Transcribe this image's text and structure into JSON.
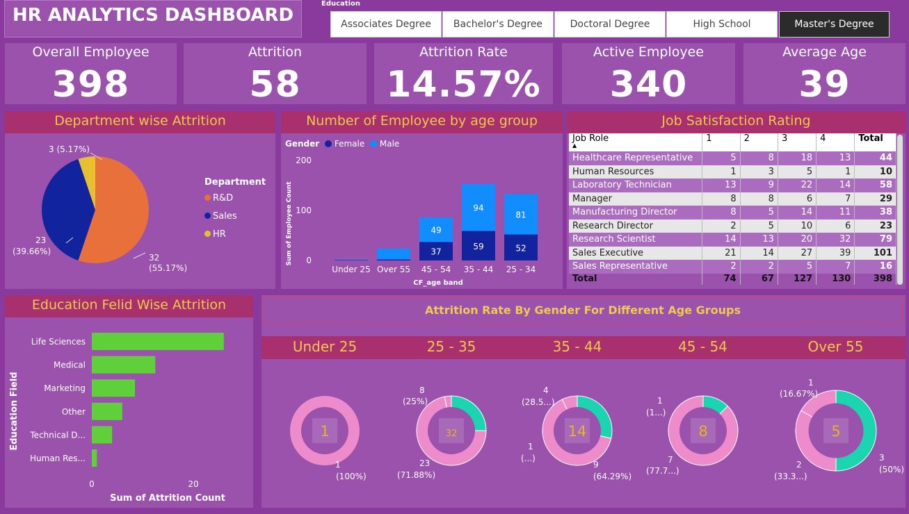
{
  "title": "HR ANALYTICS DASHBOARD",
  "slicer": {
    "label": "Education",
    "options": [
      "Associates Degree",
      "Bachelor's Degree",
      "Doctoral Degree",
      "High School",
      "Master's Degree"
    ],
    "selected": "Master's Degree"
  },
  "kpis": [
    {
      "label": "Overall Employee",
      "value": "398"
    },
    {
      "label": "Attrition",
      "value": "58"
    },
    {
      "label": "Attrition Rate",
      "value": "14.57%"
    },
    {
      "label": "Active Employee",
      "value": "340"
    },
    {
      "label": "Average Age",
      "value": "39"
    }
  ],
  "dept": {
    "title": "Department wise Attrition",
    "legend_title": "Department",
    "items": [
      {
        "name": "R&D",
        "value": 32,
        "pct": "(55.17%)",
        "color": "#e8703a"
      },
      {
        "name": "Sales",
        "value": 23,
        "pct": "(39.66%)",
        "color": "#12239e"
      },
      {
        "name": "HR",
        "value": 3,
        "pct": "(5.17%)",
        "color": "#e6c02e"
      }
    ],
    "labels": {
      "rd_value": "32",
      "rd_pct": "(55.17%)",
      "sales_value": "23",
      "sales_pct": "(39.66%)",
      "hr": "3 (5.17%)"
    }
  },
  "age_chart": {
    "title": "Number of Employee by age group",
    "legend_title": "Gender",
    "ylabel": "Sum of Employee Count",
    "xlabel": "CF_age band"
  },
  "edu_chart": {
    "title": "Education Felid Wise Attrition",
    "ylabel": "Education Field",
    "xlabel": "Sum of Attrition Count"
  },
  "job_sat": {
    "title": "Job Satisfaction Rating",
    "columns": [
      "Job Role",
      "1",
      "2",
      "3",
      "4",
      "Total"
    ],
    "rows": [
      [
        "Healthcare Representative",
        "5",
        "8",
        "18",
        "13",
        "44"
      ],
      [
        "Human Resources",
        "1",
        "3",
        "5",
        "1",
        "10"
      ],
      [
        "Laboratory Technician",
        "13",
        "9",
        "22",
        "14",
        "58"
      ],
      [
        "Manager",
        "8",
        "8",
        "6",
        "7",
        "29"
      ],
      [
        "Manufacturing Director",
        "8",
        "5",
        "14",
        "11",
        "38"
      ],
      [
        "Research Director",
        "2",
        "5",
        "10",
        "6",
        "23"
      ],
      [
        "Research Scientist",
        "14",
        "13",
        "20",
        "32",
        "79"
      ],
      [
        "Sales Executive",
        "21",
        "14",
        "27",
        "39",
        "101"
      ],
      [
        "Sales Representative",
        "2",
        "2",
        "5",
        "7",
        "16"
      ]
    ],
    "total": [
      "Total",
      "74",
      "67",
      "127",
      "130",
      "398"
    ]
  },
  "gender_section": {
    "title": "Attrition Rate By Gender For Different Age Groups",
    "groups": [
      {
        "name": "Under 25",
        "center": "1",
        "labels": [
          {
            "text": "1",
            "sub": "(100%)"
          }
        ]
      },
      {
        "name": "25 - 35",
        "center": "32",
        "labels": [
          {
            "text": "8",
            "sub": "(25%)"
          },
          {
            "text": "23",
            "sub": "(71.88%)"
          }
        ]
      },
      {
        "name": "35 - 44",
        "center": "14",
        "labels": [
          {
            "text": "4",
            "sub": "(28.5...)"
          },
          {
            "text": "1",
            "sub": "(...)"
          },
          {
            "text": "9",
            "sub": "(64.29%)"
          }
        ]
      },
      {
        "name": "45 - 54",
        "center": "8",
        "labels": [
          {
            "text": "1",
            "sub": "(1...)"
          },
          {
            "text": "7",
            "sub": "(77.7...)"
          }
        ]
      },
      {
        "name": "Over 55",
        "center": "5",
        "labels": [
          {
            "text": "1",
            "sub": "(16.67%)"
          },
          {
            "text": "2",
            "sub": "(33.3...)"
          },
          {
            "text": "3",
            "sub": "(50%)"
          }
        ]
      }
    ]
  },
  "colors": {
    "female": "#12239e",
    "male": "#118dff",
    "bar_green": "#5fd03a",
    "teal": "#1bd4b0",
    "pink": "#ee8ccb"
  },
  "chart_data": [
    {
      "type": "pie",
      "title": "Department wise Attrition",
      "categories": [
        "R&D",
        "Sales",
        "HR"
      ],
      "values": [
        32,
        23,
        3
      ]
    },
    {
      "type": "bar",
      "title": "Number of Employee by age group",
      "categories": [
        "Under 25",
        "Over 55",
        "45 - 54",
        "35 - 44",
        "25 - 34"
      ],
      "series": [
        {
          "name": "Female",
          "values": [
            1,
            2,
            37,
            59,
            52
          ]
        },
        {
          "name": "Male",
          "values": [
            1,
            22,
            49,
            94,
            81
          ]
        }
      ],
      "xlabel": "CF_age band",
      "ylabel": "Sum of Employee Count",
      "yticks": [
        0,
        100,
        200
      ],
      "ylim": [
        0,
        200
      ]
    },
    {
      "type": "bar",
      "title": "Education Felid Wise Attrition",
      "categories": [
        "Life Sciences",
        "Medical",
        "Marketing",
        "Other",
        "Technical D...",
        "Human Res..."
      ],
      "values": [
        26,
        12.5,
        8.5,
        6,
        4,
        1
      ],
      "xlabel": "Sum of Attrition Count",
      "ylabel": "Education Field",
      "xticks": [
        0,
        20
      ]
    },
    {
      "type": "pie",
      "title": "Attrition Rate By Gender For Different Age Groups",
      "groups": [
        {
          "name": "Under 25",
          "values": [
            0,
            1
          ]
        },
        {
          "name": "25 - 35",
          "values": [
            1,
            8,
            23
          ]
        },
        {
          "name": "35 - 44",
          "values": [
            4,
            1,
            9
          ]
        },
        {
          "name": "45 - 54",
          "values": [
            1,
            7
          ]
        },
        {
          "name": "Over 55",
          "values": [
            3,
            1,
            2
          ]
        }
      ]
    }
  ]
}
